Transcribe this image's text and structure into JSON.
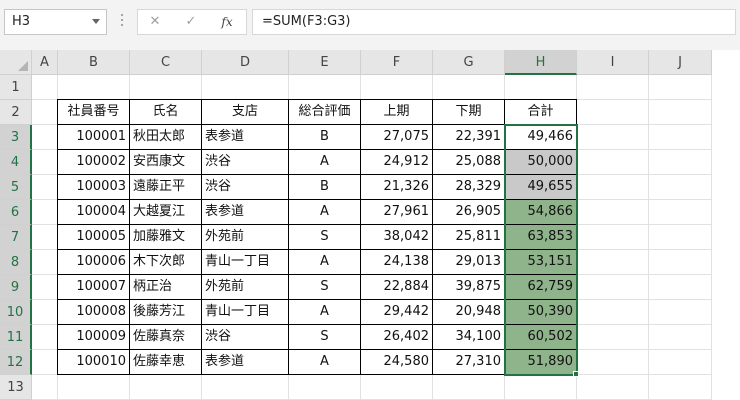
{
  "name_box": {
    "value": "H3"
  },
  "formula_bar": {
    "cancel_icon": "✕",
    "enter_icon": "✓",
    "fx_icon": "fx",
    "formula": "=SUM(F3:G3)"
  },
  "columns": [
    "A",
    "B",
    "C",
    "D",
    "E",
    "F",
    "G",
    "H",
    "I",
    "J"
  ],
  "selected_column": "H",
  "rows": [
    "1",
    "2",
    "3",
    "4",
    "5",
    "6",
    "7",
    "8",
    "9",
    "10",
    "11",
    "12",
    "13"
  ],
  "selected_rows": [
    "3",
    "4",
    "5",
    "6",
    "7",
    "8",
    "9",
    "10",
    "11",
    "12"
  ],
  "headers": [
    "社員番号",
    "氏名",
    "支店",
    "総合評価",
    "上期",
    "下期",
    "合計"
  ],
  "records": [
    {
      "id": "100001",
      "name": "秋田太郎",
      "branch": "表参道",
      "rating": "B",
      "h1": "27,075",
      "h2": "22,391",
      "total": "49,466",
      "fill": "none"
    },
    {
      "id": "100002",
      "name": "安西康文",
      "branch": "渋谷",
      "rating": "A",
      "h1": "24,912",
      "h2": "25,088",
      "total": "50,000",
      "fill": "grey"
    },
    {
      "id": "100003",
      "name": "遠藤正平",
      "branch": "渋谷",
      "rating": "B",
      "h1": "21,326",
      "h2": "28,329",
      "total": "49,655",
      "fill": "grey"
    },
    {
      "id": "100004",
      "name": "大越夏江",
      "branch": "表参道",
      "rating": "A",
      "h1": "27,961",
      "h2": "26,905",
      "total": "54,866",
      "fill": "green"
    },
    {
      "id": "100005",
      "name": "加藤雅文",
      "branch": "外苑前",
      "rating": "S",
      "h1": "38,042",
      "h2": "25,811",
      "total": "63,853",
      "fill": "green"
    },
    {
      "id": "100006",
      "name": "木下次郎",
      "branch": "青山一丁目",
      "rating": "A",
      "h1": "24,138",
      "h2": "29,013",
      "total": "53,151",
      "fill": "green"
    },
    {
      "id": "100007",
      "name": "柄正治",
      "branch": "外苑前",
      "rating": "S",
      "h1": "22,884",
      "h2": "39,875",
      "total": "62,759",
      "fill": "green"
    },
    {
      "id": "100008",
      "name": "後藤芳江",
      "branch": "青山一丁目",
      "rating": "A",
      "h1": "29,442",
      "h2": "20,948",
      "total": "50,390",
      "fill": "green"
    },
    {
      "id": "100009",
      "name": "佐藤真奈",
      "branch": "渋谷",
      "rating": "S",
      "h1": "26,402",
      "h2": "34,100",
      "total": "60,502",
      "fill": "green"
    },
    {
      "id": "100010",
      "name": "佐藤幸恵",
      "branch": "表参道",
      "rating": "A",
      "h1": "24,580",
      "h2": "27,310",
      "total": "51,890",
      "fill": "green"
    }
  ],
  "colors": {
    "accent": "#217346",
    "grey_fill": "#c9c9c9",
    "green_fill": "#8fb48b"
  }
}
